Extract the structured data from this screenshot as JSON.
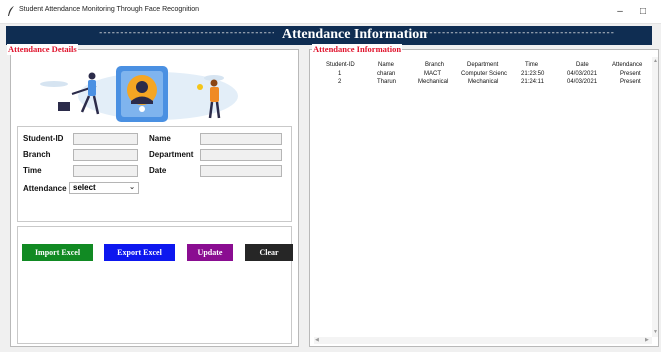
{
  "window": {
    "title": "Student Attendance Monitoring Through Face Recognition",
    "minimize": "–",
    "maximize": "□"
  },
  "banner": {
    "dashes_left": "--------------------------------------------",
    "title": "Attendance Information",
    "dashes_right": "------------------------------------------------"
  },
  "left_panel": {
    "legend": "Attendance Details",
    "labels": {
      "student_id": "Student-ID",
      "name": "Name",
      "branch": "Branch",
      "department": "Department",
      "time": "Time",
      "date": "Date",
      "attendance": "Attendance"
    },
    "values": {
      "student_id": "",
      "name": "",
      "branch": "",
      "department": "",
      "time": "",
      "date": ""
    },
    "attendance_select": "select",
    "buttons": {
      "import": "Import Excel",
      "export": "Export Excel",
      "update": "Update",
      "clear": "Clear"
    }
  },
  "right_panel": {
    "legend": "Attendance Information",
    "columns": [
      "Student-ID",
      "Name",
      "Branch",
      "Department",
      "Time",
      "Date",
      "Attendance"
    ],
    "rows": [
      [
        "1",
        "charan",
        "MACT",
        "Computer Scienc",
        "21:23:50",
        "04/03/2021",
        "Present"
      ],
      [
        "2",
        "Tharun",
        "Mechanical",
        "Mechanical",
        "21:24:11",
        "04/03/2021",
        "Present"
      ]
    ]
  },
  "colors": {
    "banner": "#0f2d52",
    "legend_red": "#e0122b",
    "import": "#118a23",
    "export": "#0d17ef",
    "update": "#8a0d91",
    "clear": "#262626"
  },
  "icons": {
    "app": "feather-icon",
    "scroll_up": "arrow-up-icon",
    "scroll_down": "arrow-down-icon",
    "scroll_left": "arrow-left-icon",
    "scroll_right": "arrow-right-icon"
  }
}
